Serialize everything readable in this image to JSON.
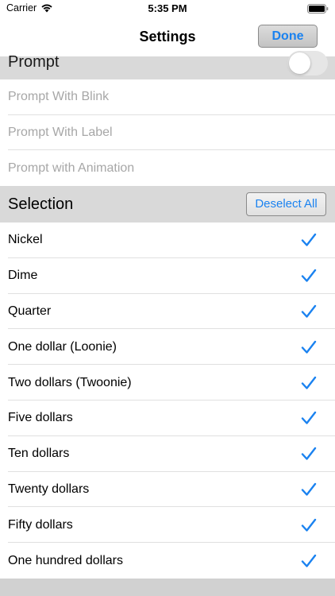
{
  "status_bar": {
    "carrier": "Carrier",
    "time": "5:35 PM"
  },
  "nav": {
    "title": "Settings",
    "done_label": "Done"
  },
  "prompt_section": {
    "header": "Prompt",
    "toggle_on": false,
    "items": [
      {
        "label": "Prompt With Blink",
        "enabled": false
      },
      {
        "label": "Prompt With Label",
        "enabled": false
      },
      {
        "label": "Prompt with Animation",
        "enabled": false
      }
    ]
  },
  "selection_section": {
    "header": "Selection",
    "deselect_label": "Deselect All",
    "items": [
      {
        "label": "Nickel",
        "checked": true
      },
      {
        "label": "Dime",
        "checked": true
      },
      {
        "label": "Quarter",
        "checked": true
      },
      {
        "label": "One dollar (Loonie)",
        "checked": true
      },
      {
        "label": "Two dollars (Twoonie)",
        "checked": true
      },
      {
        "label": "Five dollars",
        "checked": true
      },
      {
        "label": "Ten dollars",
        "checked": true
      },
      {
        "label": "Twenty dollars",
        "checked": true
      },
      {
        "label": "Fifty dollars",
        "checked": true
      },
      {
        "label": "One hundred dollars",
        "checked": true
      }
    ]
  },
  "colors": {
    "accent": "#1a82f0",
    "disabled_text": "#a7a7a7",
    "section_background": "#d9d9d9"
  },
  "icons": {
    "wifi": "wifi-icon",
    "battery": "battery-icon",
    "checkmark": "checkmark-icon"
  }
}
